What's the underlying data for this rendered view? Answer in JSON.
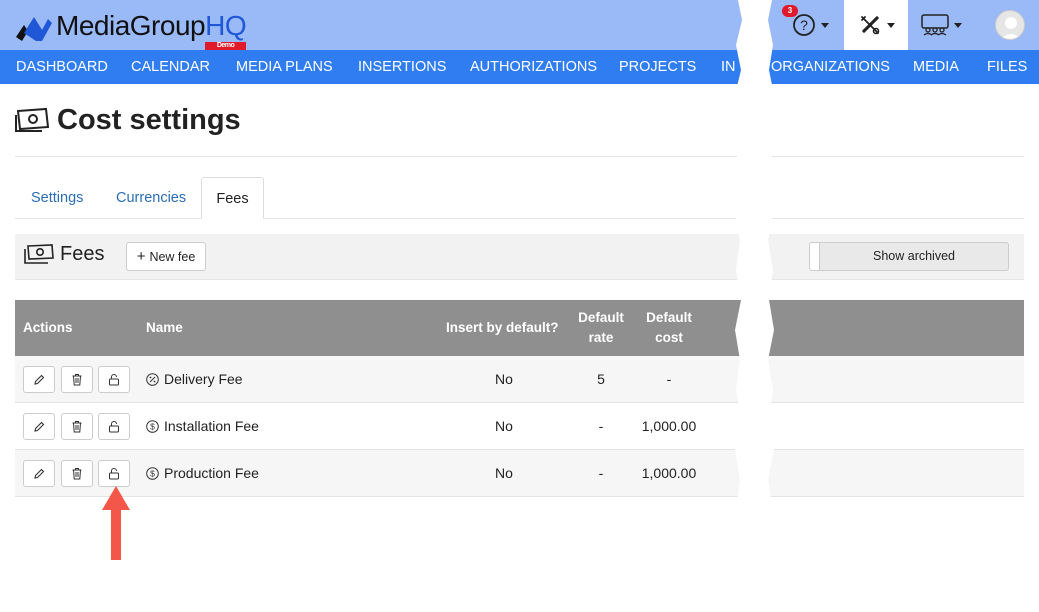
{
  "app": {
    "logo_main": "MediaGroup",
    "logo_hq": "HQ",
    "logo_demo": "Demo",
    "notification_count": "3"
  },
  "topbar_icons": [
    "help-icon",
    "tools-icon",
    "team-icon",
    "user-avatar"
  ],
  "nav": [
    "DASHBOARD",
    "CALENDAR",
    "MEDIA PLANS",
    "INSERTIONS",
    "AUTHORIZATIONS",
    "PROJECTS",
    "IN",
    "ORGANIZATIONS",
    "MEDIA",
    "FILES"
  ],
  "page": {
    "title": "Cost settings"
  },
  "tabs": [
    {
      "label": "Settings"
    },
    {
      "label": "Currencies"
    },
    {
      "label": "Fees"
    }
  ],
  "fees_section": {
    "title": "Fees",
    "new_button": "New fee",
    "show_archived": "Show archived"
  },
  "table": {
    "headers": {
      "actions": "Actions",
      "name": "Name",
      "insert_default": "Insert by default?",
      "default_rate_1": "Default",
      "default_rate_2": "rate",
      "default_cost_1": "Default",
      "default_cost_2": "cost"
    },
    "rows": [
      {
        "icon": "percent-icon",
        "name": "Delivery Fee",
        "insert_default": "No",
        "rate": "5",
        "cost": "-"
      },
      {
        "icon": "dollar-icon",
        "name": "Installation Fee",
        "insert_default": "No",
        "rate": "-",
        "cost": "1,000.00"
      },
      {
        "icon": "dollar-icon",
        "name": "Production Fee",
        "insert_default": "No",
        "rate": "-",
        "cost": "1,000.00"
      }
    ]
  },
  "colors": {
    "topbar": "#9ab9f7",
    "nav": "#2f7df0",
    "table_header": "#8f8f8f",
    "annotation_arrow": "#f2574a"
  }
}
